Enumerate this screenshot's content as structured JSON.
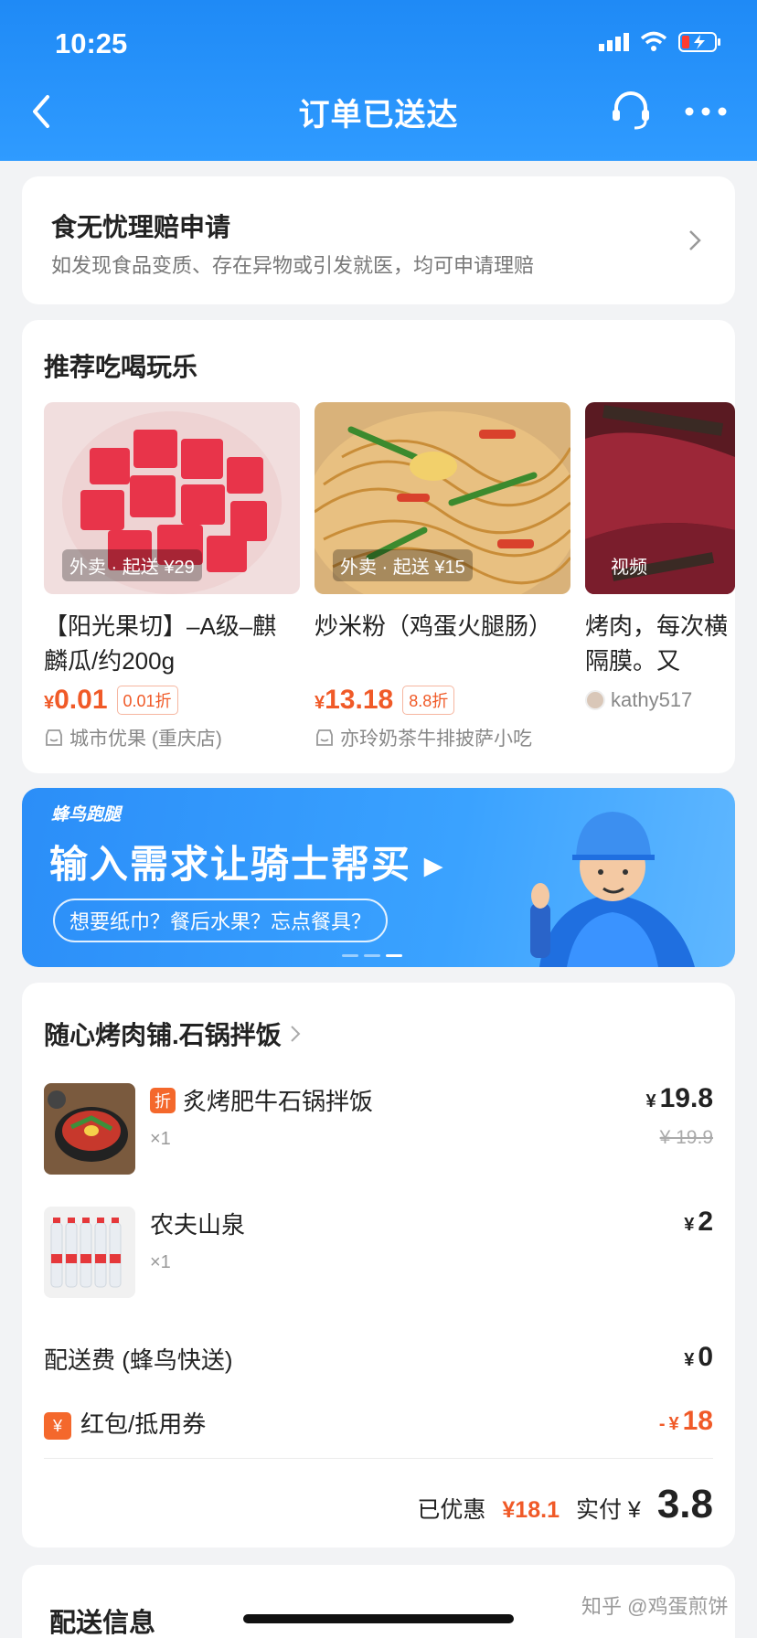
{
  "status": {
    "time": "10:25"
  },
  "nav": {
    "title": "订单已送达"
  },
  "claim": {
    "title": "食无忧理赔申请",
    "desc": "如发现食品变质、存在异物或引发就医，均可申请理赔"
  },
  "recommend": {
    "title": "推荐吃喝玩乐",
    "items": [
      {
        "tag": "外卖 · 起送 ¥29",
        "name": "【阳光果切】–A级–麒麟瓜/约200g",
        "price_symbol": "¥",
        "price": "0.01",
        "discount": "0.01折",
        "shop": "城市优果 (重庆店)"
      },
      {
        "tag": "外卖 · 起送 ¥15",
        "name": "炒米粉（鸡蛋火腿肠）",
        "price_symbol": "¥",
        "price": "13.18",
        "discount": "8.8折",
        "shop": "亦玲奶茶牛排披萨小吃"
      },
      {
        "tag": "视频",
        "name": "烤肉，每次横隔膜。又",
        "author": "kathy517"
      }
    ]
  },
  "banner": {
    "brand": "蜂鸟跑腿",
    "title": "输入需求让骑士帮买 ▸",
    "subtitle": "想要纸巾？餐后水果？忘点餐具？"
  },
  "order": {
    "shop_name": "随心烤肉铺.石锅拌饭",
    "items": [
      {
        "badge": "折",
        "name": "炙烤肥牛石锅拌饭",
        "qty": "×1",
        "currency": "¥",
        "price": "19.8",
        "original_price": "¥ 19.9"
      },
      {
        "name": "农夫山泉",
        "qty": "×1",
        "currency": "¥",
        "price": "2"
      }
    ],
    "delivery_fee": {
      "label": "配送费 (蜂鸟快送)",
      "currency": "¥",
      "value": "0"
    },
    "coupon": {
      "icon": "¥",
      "label": "红包/抵用券",
      "prefix": "-",
      "currency": "¥",
      "value": "18"
    },
    "totals": {
      "saved_label": "已优惠",
      "saved_value": "¥18.1",
      "paid_label": "实付 ¥",
      "paid_value": "3.8"
    }
  },
  "delivery": {
    "title": "配送信息"
  },
  "watermark": "知乎 @鸡蛋煎饼",
  "colors": {
    "header_blue": "#1f8af6",
    "accent_orange": "#f05a28",
    "background": "#f2f3f5"
  }
}
